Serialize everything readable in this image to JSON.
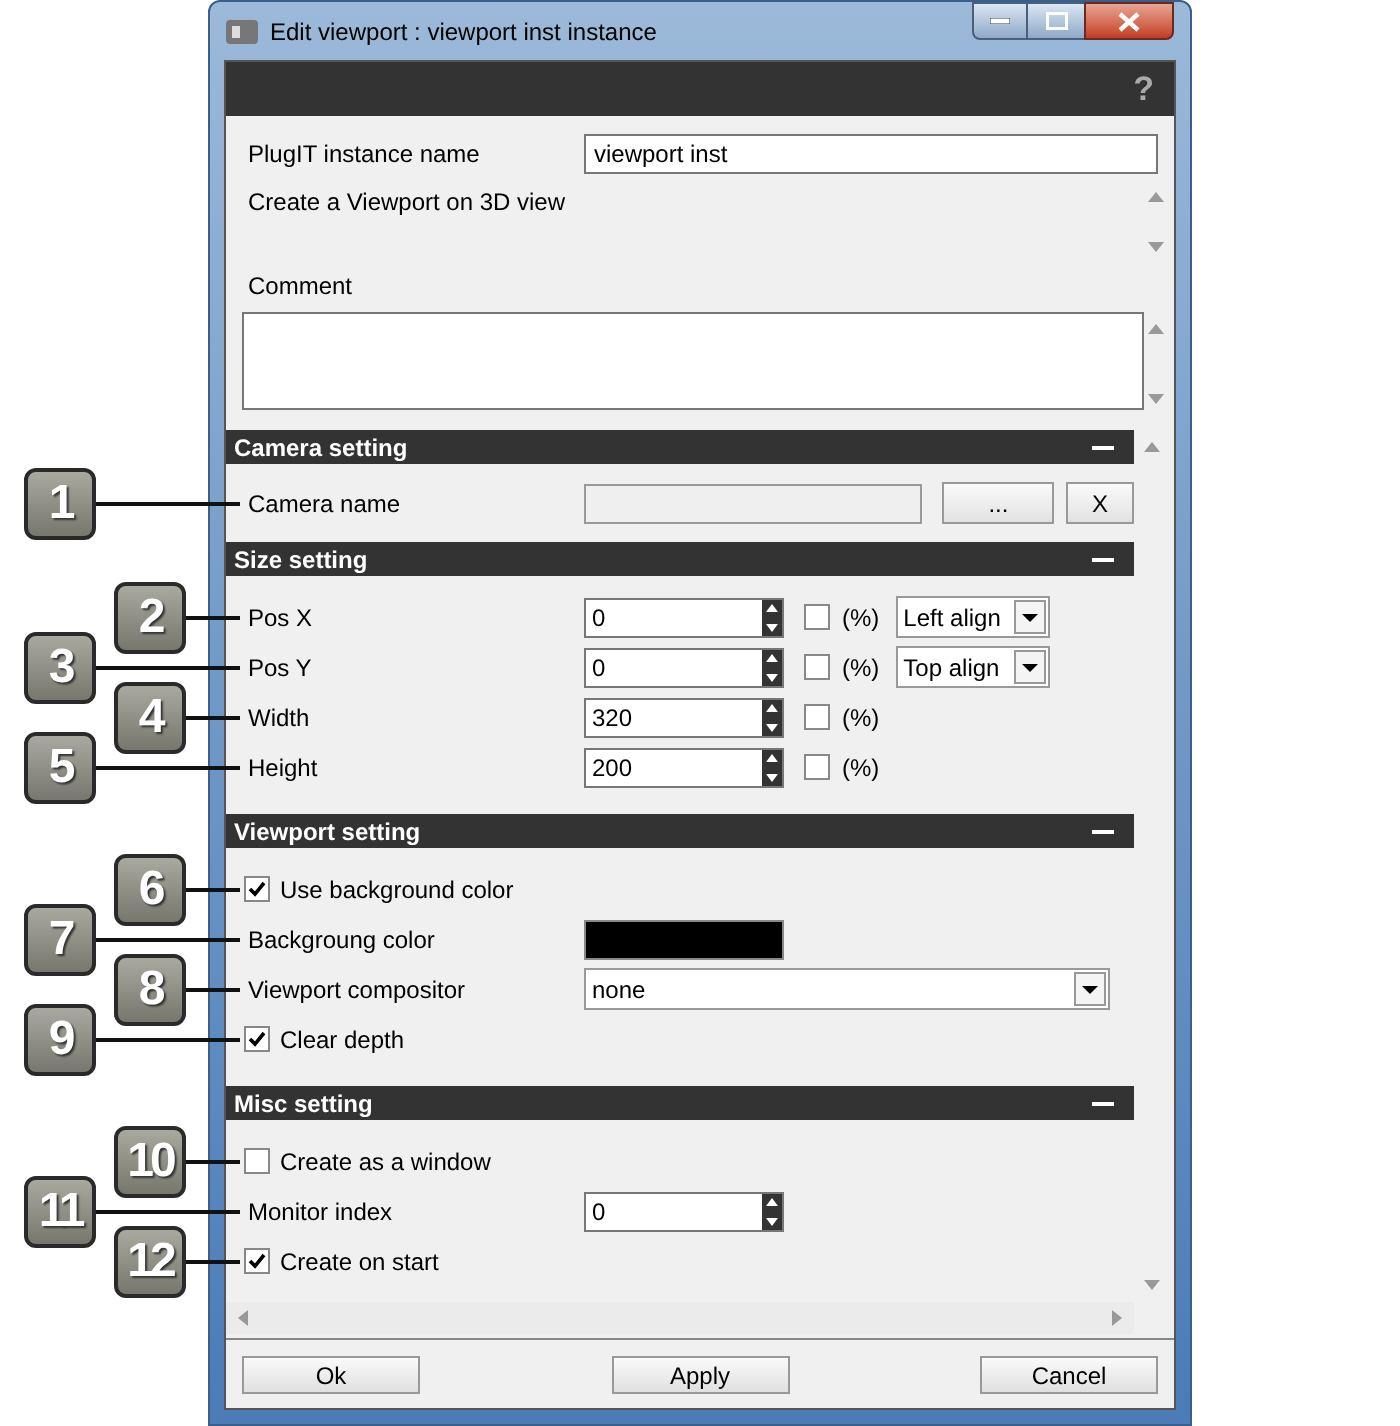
{
  "window": {
    "title": "Edit viewport : viewport inst instance",
    "help": "?"
  },
  "instance_name": {
    "label": "PlugIT instance name",
    "value": "viewport inst"
  },
  "description": "Create a Viewport on 3D view",
  "comment": {
    "label": "Comment"
  },
  "sections": [
    {
      "title": "Camera setting",
      "rows": [
        {
          "kind": "picker",
          "callout": "1",
          "label": "Camera name",
          "browse": "...",
          "clear": "X"
        }
      ]
    },
    {
      "title": "Size setting",
      "rows": [
        {
          "kind": "spin",
          "callout": "2",
          "label": "Pos X",
          "value": "0",
          "percent": {
            "label": "(%)",
            "checked": false
          },
          "align": "Left align"
        },
        {
          "kind": "spin",
          "callout": "3",
          "label": "Pos Y",
          "value": "0",
          "percent": {
            "label": "(%)",
            "checked": false
          },
          "align": "Top align"
        },
        {
          "kind": "spin",
          "callout": "4",
          "label": "Width",
          "value": "320",
          "percent": {
            "label": "(%)",
            "checked": false
          }
        },
        {
          "kind": "spin",
          "callout": "5",
          "label": "Height",
          "value": "200",
          "percent": {
            "label": "(%)",
            "checked": false
          }
        }
      ]
    },
    {
      "title": "Viewport setting",
      "rows": [
        {
          "kind": "check",
          "callout": "6",
          "label": "Use background color",
          "checked": true
        },
        {
          "kind": "color",
          "callout": "7",
          "label": "Backgroung color",
          "color": "#000000"
        },
        {
          "kind": "select",
          "callout": "8",
          "label": "Viewport compositor",
          "value": "none"
        },
        {
          "kind": "check",
          "callout": "9",
          "label": "Clear depth",
          "checked": true
        }
      ]
    },
    {
      "title": "Misc setting",
      "rows": [
        {
          "kind": "check",
          "callout": "10",
          "label": "Create as a window",
          "checked": false
        },
        {
          "kind": "spin",
          "callout": "11",
          "label": "Monitor index",
          "value": "0"
        },
        {
          "kind": "check",
          "callout": "12",
          "label": "Create on start",
          "checked": true
        }
      ]
    }
  ],
  "buttons": [
    "Ok",
    "Apply",
    "Cancel"
  ]
}
